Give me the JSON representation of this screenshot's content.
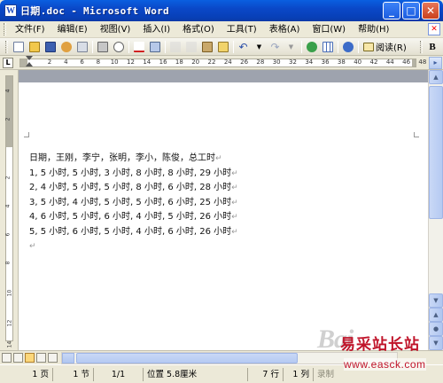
{
  "window": {
    "title": "日期.doc - Microsoft Word",
    "app_icon_letter": "W"
  },
  "menu": {
    "items": [
      "文件(F)",
      "编辑(E)",
      "视图(V)",
      "插入(I)",
      "格式(O)",
      "工具(T)",
      "表格(A)",
      "窗口(W)",
      "帮助(H)"
    ]
  },
  "toolbar": {
    "read_label": "阅读(R)",
    "bold_label": "B",
    "icons": [
      "new-icon",
      "open-icon",
      "save-icon",
      "permission-icon",
      "email-icon",
      "print-icon",
      "print-preview-icon",
      "spelling-icon",
      "research-icon",
      "cut-icon",
      "copy-icon",
      "paste-icon",
      "format-painter-icon",
      "undo-icon",
      "redo-icon",
      "hyperlink-icon",
      "table-icon",
      "help-icon",
      "read-icon"
    ]
  },
  "ruler": {
    "corner_label": "L",
    "numbers": [
      "2",
      "4",
      "6",
      "8",
      "10",
      "12",
      "14",
      "16",
      "18",
      "20",
      "22",
      "24",
      "26",
      "28",
      "30",
      "32",
      "34",
      "36",
      "38",
      "40",
      "42",
      "44",
      "46",
      "48"
    ],
    "vertical_numbers": [
      "4",
      "2",
      "2",
      "4",
      "6",
      "8",
      "10",
      "12",
      "14"
    ]
  },
  "document": {
    "lines": [
      "日期，王刚，李宁，张明，李小，陈俊，总工时",
      "1, 5 小时, 5 小时, 3 小时, 8 小时, 8 小时, 29 小时",
      "2, 4 小时, 5 小时, 5 小时, 8 小时, 6 小时, 28 小时",
      "3, 5 小时, 4 小时, 5 小时, 5 小时, 6 小时, 25 小时",
      "4, 6 小时, 5 小时, 6 小时, 4 小时, 5 小时, 26 小时",
      "5, 5 小时, 6 小时, 5 小时, 4 小时, 6 小时, 26 小时"
    ],
    "para_mark": "↵"
  },
  "status": {
    "page": "1 页",
    "section": "1 节",
    "page_of": "1/1",
    "position": "位置 5.8厘米",
    "line": "7 行",
    "column": "1 列",
    "record": "录制"
  },
  "watermark": {
    "baidu": "Bai",
    "chinese": "易采站长站",
    "url": "www.easck.com"
  }
}
